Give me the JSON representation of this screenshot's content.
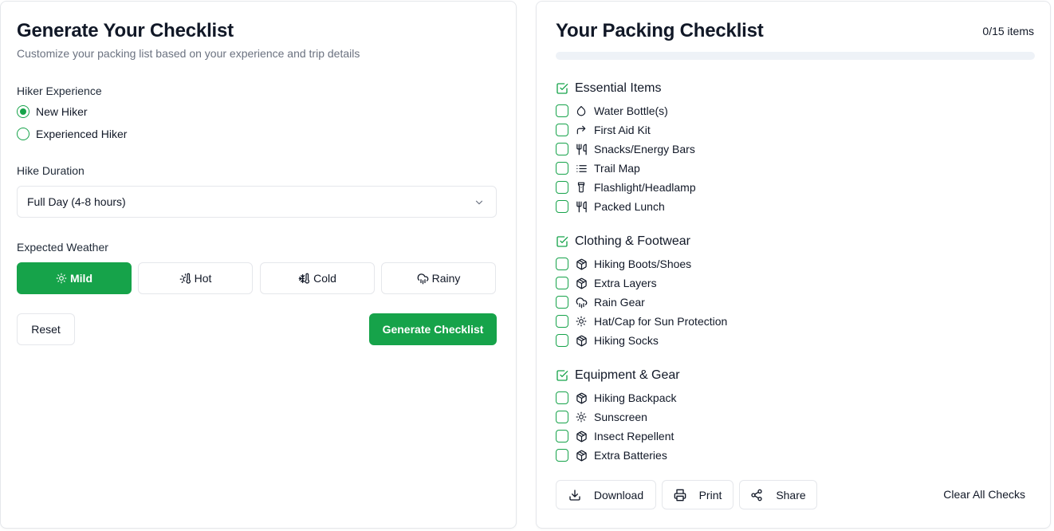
{
  "colors": {
    "accent": "#16a34a",
    "muted": "#6b7280",
    "border": "#e5e7eb"
  },
  "generator": {
    "title": "Generate Your Checklist",
    "subtitle": "Customize your packing list based on your experience and trip details",
    "experience": {
      "label": "Hiker Experience",
      "options": [
        {
          "label": "New Hiker",
          "selected": true
        },
        {
          "label": "Experienced Hiker",
          "selected": false
        }
      ]
    },
    "duration": {
      "label": "Hike Duration",
      "value": "Full Day (4-8 hours)",
      "icon": "chevron-down-icon"
    },
    "weather": {
      "label": "Expected Weather",
      "options": [
        {
          "label": "Mild",
          "icon": "sun-icon",
          "active": true
        },
        {
          "label": "Hot",
          "icon": "thermometer-sun-icon",
          "active": false
        },
        {
          "label": "Cold",
          "icon": "thermometer-snowflake-icon",
          "active": false
        },
        {
          "label": "Rainy",
          "icon": "cloud-rain-icon",
          "active": false
        }
      ]
    },
    "reset_label": "Reset",
    "generate_label": "Generate Checklist"
  },
  "checklist": {
    "title": "Your Packing Checklist",
    "count_text": "0/15 items",
    "progress": 0,
    "categories": [
      {
        "name": "Essential Items",
        "icon": "square-check-icon",
        "items": [
          {
            "label": "Water Bottle(s)",
            "icon": "droplet-icon",
            "checked": false
          },
          {
            "label": "First Aid Kit",
            "icon": "forward-arrow-icon",
            "checked": false
          },
          {
            "label": "Snacks/Energy Bars",
            "icon": "utensils-icon",
            "checked": false
          },
          {
            "label": "Trail Map",
            "icon": "list-icon",
            "checked": false
          },
          {
            "label": "Flashlight/Headlamp",
            "icon": "flashlight-icon",
            "checked": false
          },
          {
            "label": "Packed Lunch",
            "icon": "utensils-icon",
            "checked": false
          }
        ]
      },
      {
        "name": "Clothing & Footwear",
        "icon": "square-check-icon",
        "items": [
          {
            "label": "Hiking Boots/Shoes",
            "icon": "package-icon",
            "checked": false
          },
          {
            "label": "Extra Layers",
            "icon": "package-icon",
            "checked": false
          },
          {
            "label": "Rain Gear",
            "icon": "cloud-rain-icon",
            "checked": false
          },
          {
            "label": "Hat/Cap for Sun Protection",
            "icon": "sun-icon",
            "checked": false
          },
          {
            "label": "Hiking Socks",
            "icon": "package-icon",
            "checked": false
          }
        ]
      },
      {
        "name": "Equipment & Gear",
        "icon": "square-check-icon",
        "items": [
          {
            "label": "Hiking Backpack",
            "icon": "package-icon",
            "checked": false
          },
          {
            "label": "Sunscreen",
            "icon": "sun-icon",
            "checked": false
          },
          {
            "label": "Insect Repellent",
            "icon": "package-icon",
            "checked": false
          },
          {
            "label": "Extra Batteries",
            "icon": "package-icon",
            "checked": false
          }
        ]
      }
    ],
    "actions": {
      "download_label": "Download",
      "print_label": "Print",
      "share_label": "Share",
      "clear_label": "Clear All Checks"
    }
  }
}
